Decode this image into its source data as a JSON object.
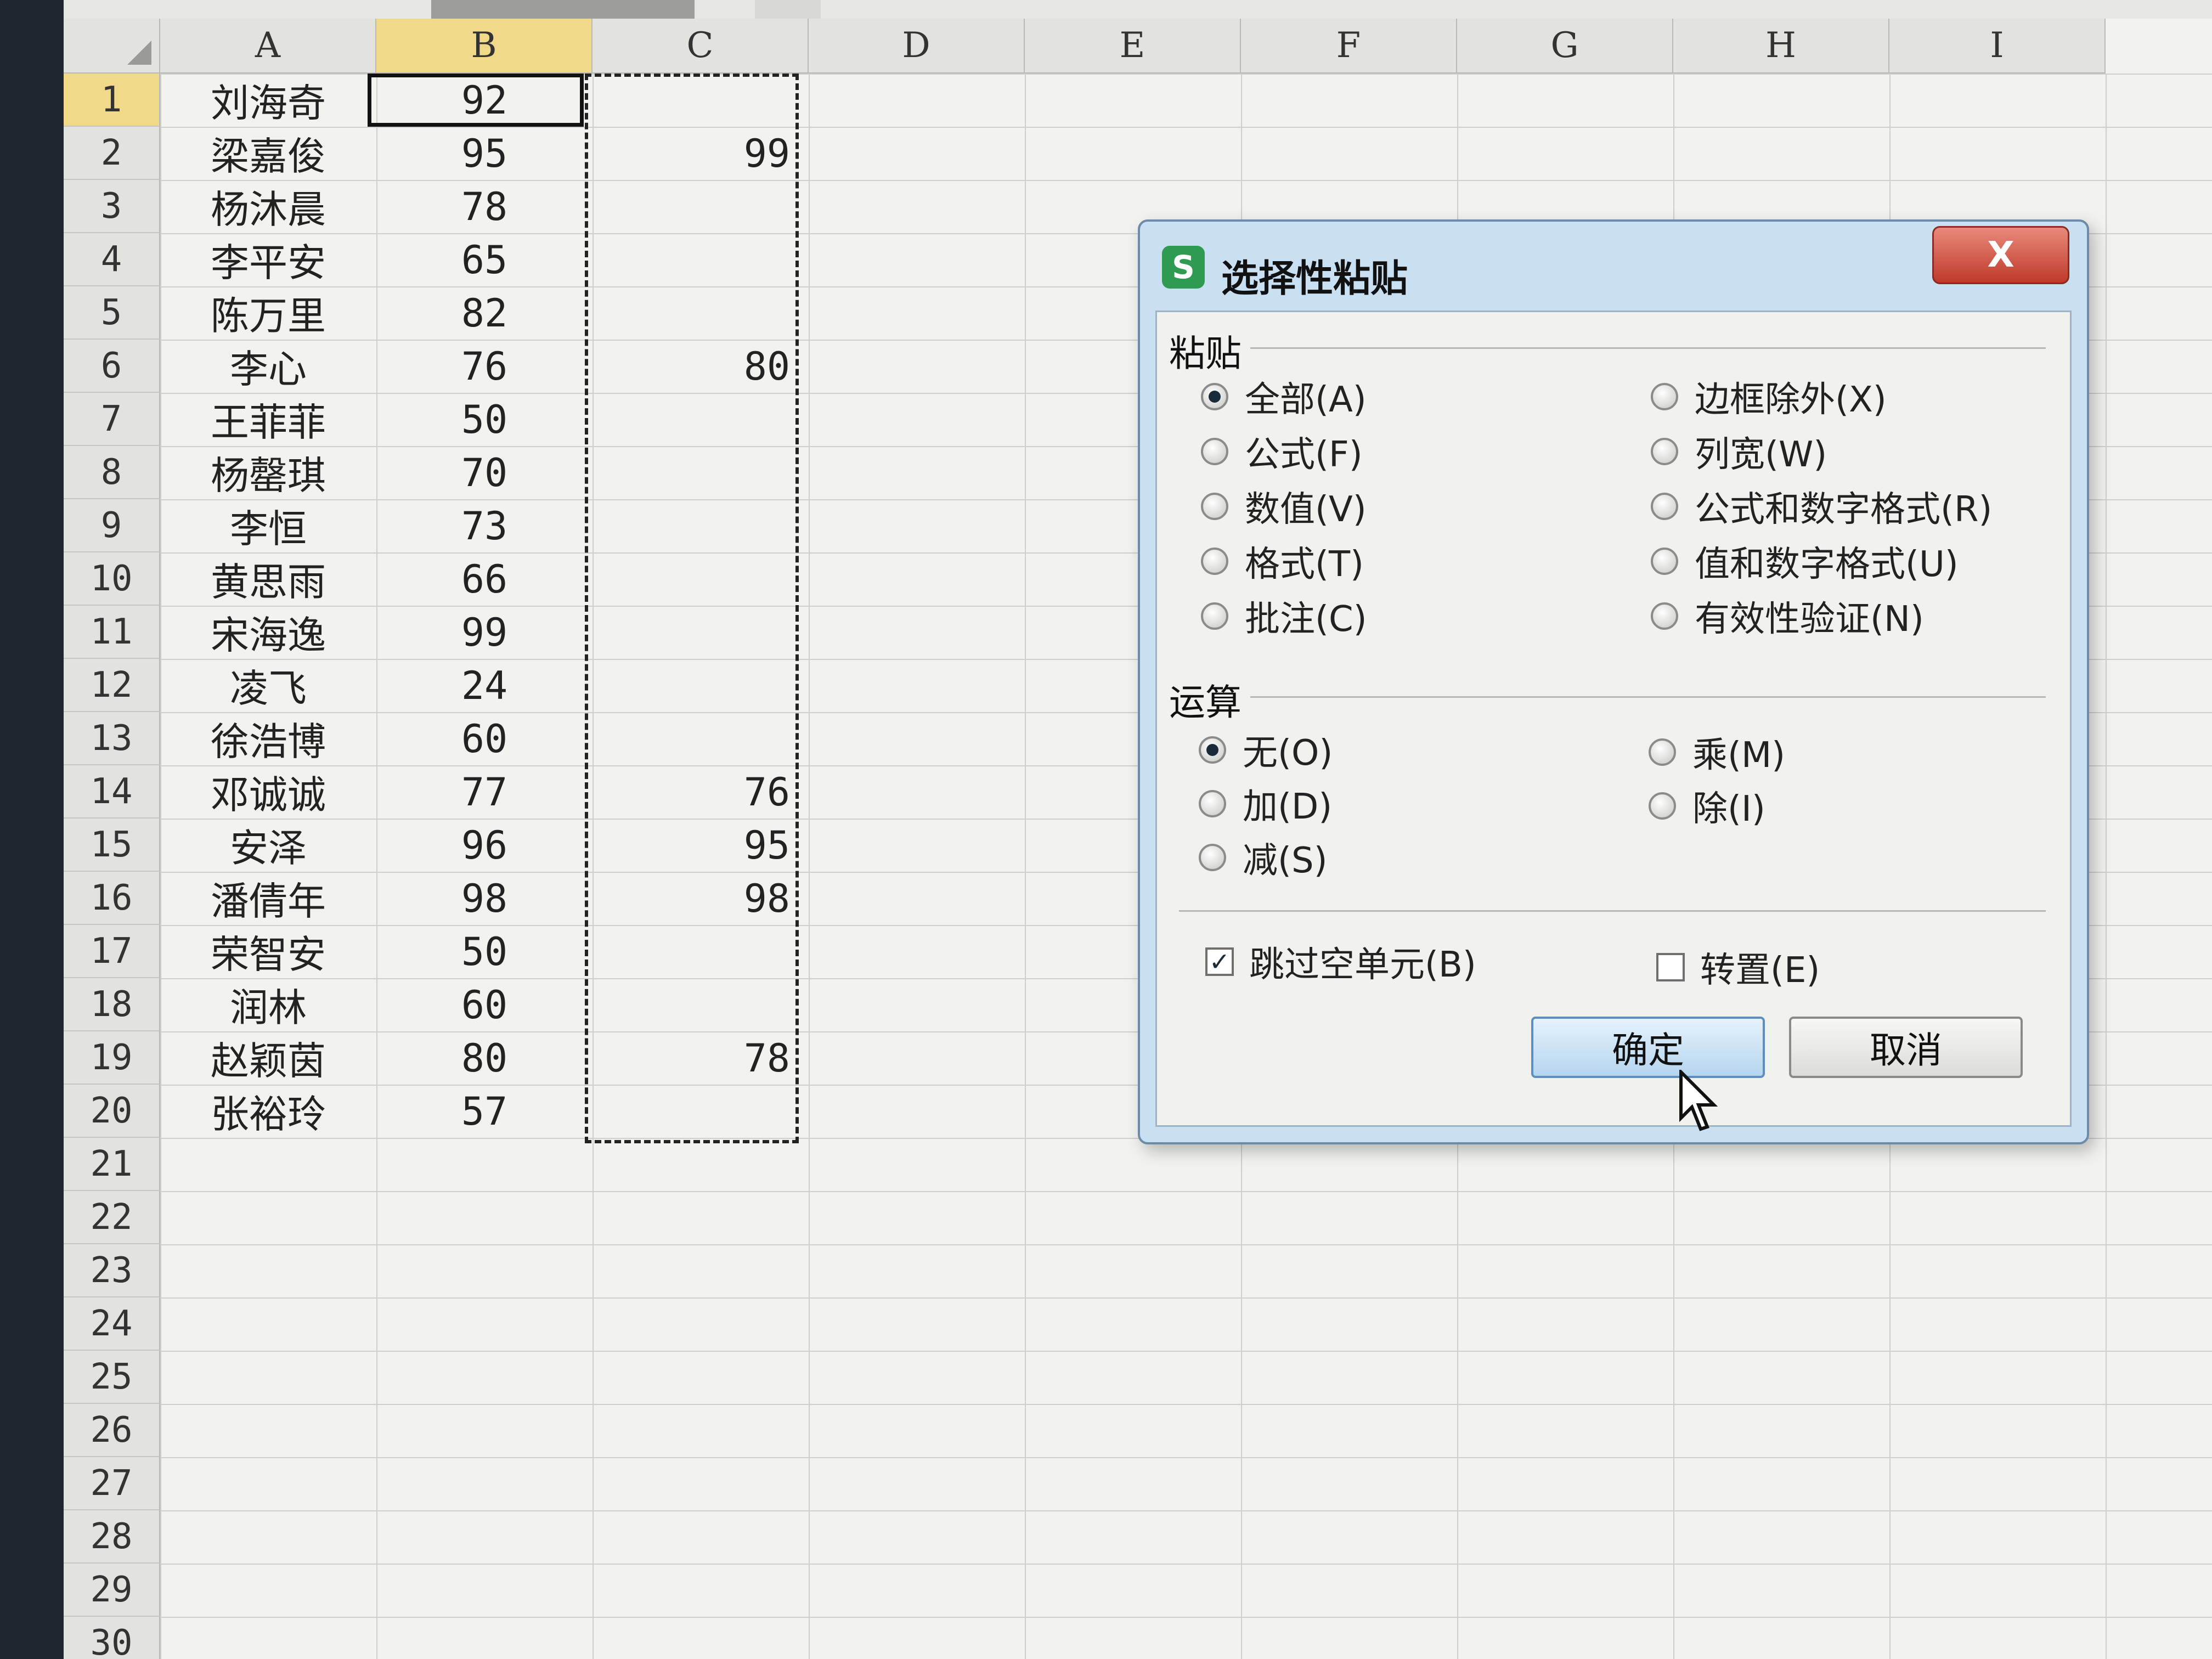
{
  "spreadsheet": {
    "columns": [
      "A",
      "B",
      "C",
      "D",
      "E",
      "F",
      "G",
      "H",
      "I"
    ],
    "rows": [
      {
        "num": "1",
        "name": "刘海奇",
        "b": "92",
        "c": ""
      },
      {
        "num": "2",
        "name": "梁嘉俊",
        "b": "95",
        "c": "99"
      },
      {
        "num": "3",
        "name": "杨沐晨",
        "b": "78",
        "c": ""
      },
      {
        "num": "4",
        "name": "李平安",
        "b": "65",
        "c": ""
      },
      {
        "num": "5",
        "name": "陈万里",
        "b": "82",
        "c": ""
      },
      {
        "num": "6",
        "name": "李心",
        "b": "76",
        "c": "80"
      },
      {
        "num": "7",
        "name": "王菲菲",
        "b": "50",
        "c": ""
      },
      {
        "num": "8",
        "name": "杨罄琪",
        "b": "70",
        "c": ""
      },
      {
        "num": "9",
        "name": "李恒",
        "b": "73",
        "c": ""
      },
      {
        "num": "10",
        "name": "黄思雨",
        "b": "66",
        "c": ""
      },
      {
        "num": "11",
        "name": "宋海逸",
        "b": "99",
        "c": ""
      },
      {
        "num": "12",
        "name": "凌飞",
        "b": "24",
        "c": ""
      },
      {
        "num": "13",
        "name": "徐浩博",
        "b": "60",
        "c": ""
      },
      {
        "num": "14",
        "name": "邓诚诚",
        "b": "77",
        "c": "76"
      },
      {
        "num": "15",
        "name": "安泽",
        "b": "96",
        "c": "95"
      },
      {
        "num": "16",
        "name": "潘倩年",
        "b": "98",
        "c": "98"
      },
      {
        "num": "17",
        "name": "荣智安",
        "b": "50",
        "c": ""
      },
      {
        "num": "18",
        "name": "润林",
        "b": "60",
        "c": ""
      },
      {
        "num": "19",
        "name": "赵颖茵",
        "b": "80",
        "c": "78"
      },
      {
        "num": "20",
        "name": "张裕玲",
        "b": "57",
        "c": ""
      }
    ],
    "empty_rows": [
      "21",
      "22",
      "23",
      "24",
      "25",
      "26",
      "27",
      "28",
      "29",
      "30"
    ]
  },
  "dialog": {
    "title": "选择性粘贴",
    "app_icon_letter": "S",
    "close_label": "X",
    "paste_group": "粘贴",
    "paste_options_left": [
      "全部(A)",
      "公式(F)",
      "数值(V)",
      "格式(T)",
      "批注(C)"
    ],
    "paste_options_right": [
      "边框除外(X)",
      "列宽(W)",
      "公式和数字格式(R)",
      "值和数字格式(U)",
      "有效性验证(N)"
    ],
    "operation_group": "运算",
    "operation_options_left": [
      "无(O)",
      "加(D)",
      "减(S)"
    ],
    "operation_options_right": [
      "乘(M)",
      "除(I)"
    ],
    "skip_blanks": "跳过空单元(B)",
    "skip_blanks_checked": true,
    "transpose": "转置(E)",
    "transpose_checked": false,
    "ok_label": "确定",
    "cancel_label": "取消"
  }
}
